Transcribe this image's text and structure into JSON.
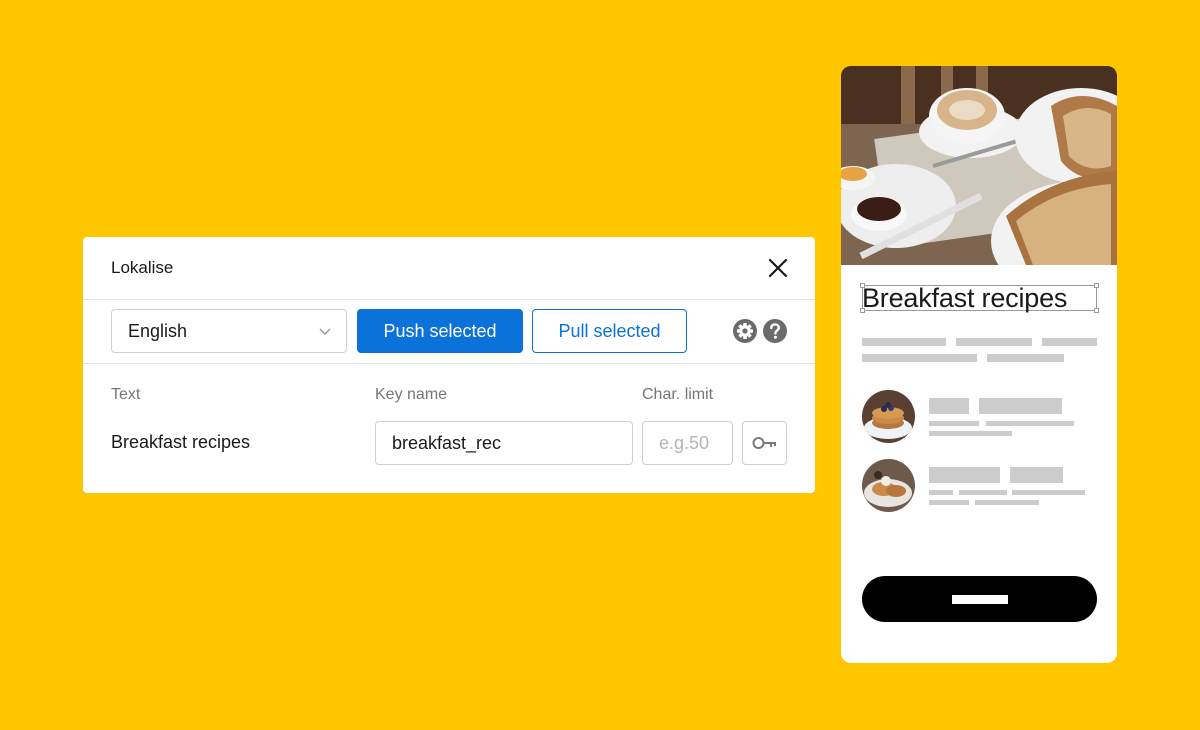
{
  "dialog": {
    "title": "Lokalise",
    "language": "English",
    "push_label": "Push selected",
    "pull_label": "Pull selected",
    "columns": {
      "text": "Text",
      "key_name": "Key name",
      "char_limit": "Char. limit"
    },
    "row": {
      "text": "Breakfast recipes",
      "key_value": "breakfast_rec",
      "char_limit_placeholder": "e.g.50"
    }
  },
  "phone": {
    "title": "Breakfast recipes"
  },
  "colors": {
    "background": "#FFC600",
    "accent": "#0A72D9",
    "placeholder_bar": "#CCCCCC",
    "cta": "#000000"
  },
  "icons": [
    "close-icon",
    "chevron-down-icon",
    "gear-icon",
    "help-icon",
    "key-icon"
  ]
}
